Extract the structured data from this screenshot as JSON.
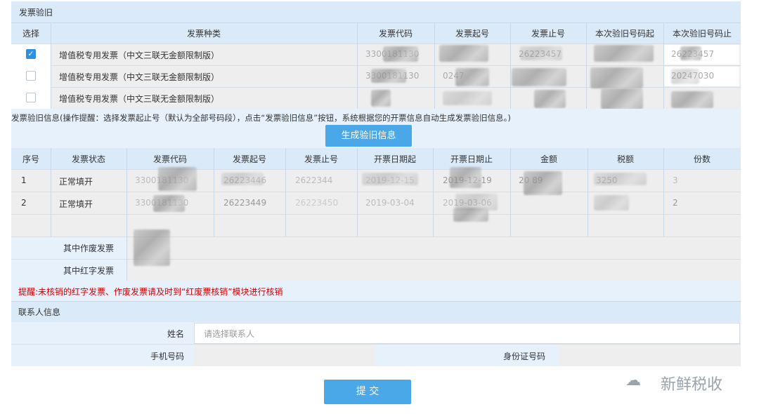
{
  "section_title": "发票验旧",
  "invoice_type_table": {
    "headers": [
      "选择",
      "发票种类",
      "发票代码",
      "发票起号",
      "发票止号",
      "本次验旧号码起",
      "本次验旧号码止"
    ],
    "rows": [
      {
        "checked": true,
        "type": "增值税专用发票（中文三联无金额限制版）",
        "code": "3300181130",
        "start": "",
        "end": "26223457",
        "verify_start": "",
        "verify_end": "26223457"
      },
      {
        "checked": false,
        "type": "增值税专用发票（中文三联无金额限制版）",
        "code": "3300181130",
        "start": "0247",
        "end": "",
        "verify_start": "",
        "verify_end": "20247030"
      },
      {
        "checked": false,
        "type": "增值税专用发票（中文三联无金额限制版）",
        "code": "",
        "start": "",
        "end": "",
        "verify_start": "",
        "verify_end": ""
      }
    ]
  },
  "info_tip": "发票验旧信息(操作提醒：选择发票起止号（默认为全部号码段），点击“发票验旧信息”按钮，系统根据您的开票信息自动生成发票验旧信息。)",
  "generate_button": "生成验旧信息",
  "detail_table": {
    "headers": [
      "序号",
      "发票状态",
      "发票代码",
      "发票起号",
      "发票止号",
      "开票日期起",
      "开票日期止",
      "金额",
      "税额",
      "份数"
    ],
    "rows": [
      {
        "no": "1",
        "status": "正常填开",
        "code": "3300181130",
        "start": "26223446",
        "end": "2622344",
        "date_start": "2019-12-15",
        "date_end": "2019-12-19",
        "amount": "20 89",
        "tax": "3250",
        "count": "3"
      },
      {
        "no": "2",
        "status": "正常填开",
        "code": "3300181130",
        "start": "26223449",
        "end": "26223450",
        "date_start": "2019-03-04",
        "date_end": "2019-03-06",
        "amount": "",
        "tax": "",
        "count": "2"
      }
    ],
    "void_label": "其中作废发票",
    "red_label": "其中红字发票"
  },
  "warning": "提醒:未核销的红字发票、作废发票请及时到“红废票核销”模块进行核销",
  "contact": {
    "title": "联系人信息",
    "name_label": "姓名",
    "name_placeholder": "请选择联系人",
    "phone_label": "手机号码",
    "id_label": "身份证号码"
  },
  "submit_button": "提 交",
  "watermark": "新鲜税收",
  "colors": {
    "header_bg": "#dbeaf9",
    "accent": "#4aa7e8",
    "warning": "#d40000"
  }
}
